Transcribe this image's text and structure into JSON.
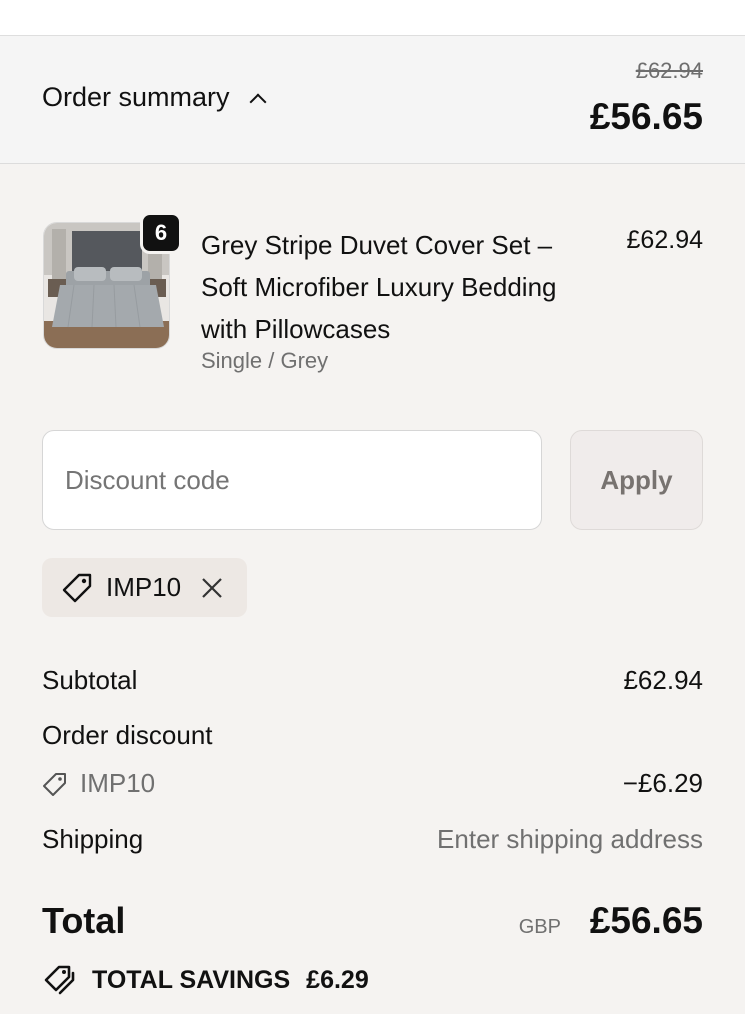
{
  "summary": {
    "label": "Order summary",
    "original_price": "£62.94",
    "total": "£56.65"
  },
  "product": {
    "quantity": "6",
    "title": "Grey Stripe Duvet Cover Set – Soft Microfiber Luxury Bedding with Pillowcases",
    "variant": "Single / Grey",
    "price": "£62.94"
  },
  "discount": {
    "placeholder": "Discount code",
    "apply_label": "Apply",
    "applied_code": "IMP10"
  },
  "totals": {
    "subtotal_label": "Subtotal",
    "subtotal_value": "£62.94",
    "order_discount_label": "Order discount",
    "discount_code": "IMP10",
    "discount_value": "−£6.29",
    "shipping_label": "Shipping",
    "shipping_value": "Enter shipping address",
    "total_label": "Total",
    "currency": "GBP",
    "total_value": "£56.65",
    "savings_label": "TOTAL SAVINGS",
    "savings_value": "£6.29"
  },
  "icons": {
    "chevron": "chevron-up-icon",
    "chip_tag": "tag-icon",
    "chip_remove": "close-icon",
    "discount_tag": "tag-icon",
    "savings": "savings-tags-icon"
  }
}
